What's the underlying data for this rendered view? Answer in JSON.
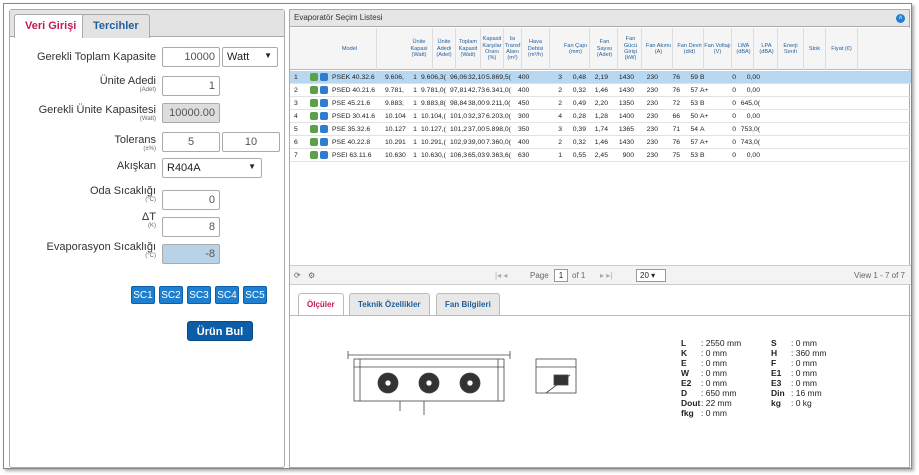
{
  "left_tabs": {
    "data_entry": "Veri Girişi",
    "preferences": "Tercihler"
  },
  "form": {
    "total_capacity_label": "Gerekli Toplam Kapasite",
    "total_capacity_value": "10000",
    "capacity_unit": "Watt",
    "unit_count_label": "Ünite Adedi",
    "unit_count_sub": "(Adet)",
    "unit_count_value": "1",
    "unit_capacity_label": "Gerekli Ünite Kapasitesi",
    "unit_capacity_sub": "(Watt)",
    "unit_capacity_value": "10000.00",
    "tolerance_label": "Tolerans",
    "tolerance_sub": "(±%)",
    "tolerance_min": "5",
    "tolerance_max": "10",
    "fluid_label": "Akışkan",
    "fluid_value": "R404A",
    "room_temp_label": "Oda Sıcaklığı",
    "room_temp_sub": "(°C)",
    "room_temp_value": "0",
    "dt_label": "ΔT",
    "dt_sub": "(K)",
    "dt_value": "8",
    "evap_temp_label": "Evaporasyon Sıcaklığı",
    "evap_temp_sub": "(°C)",
    "evap_temp_value": "-8",
    "sc_buttons": [
      "SC1",
      "SC2",
      "SC3",
      "SC4",
      "SC5"
    ],
    "find_button": "Ürün Bul"
  },
  "grid": {
    "title": "Evaporatör Seçim Listesi",
    "columns": [
      "Model",
      "Ünite Kapasi (Watt)",
      "Ünite Adedi (Adet)",
      "Toplam Kapasit (Watt)",
      "Kapasit Karşılar Oranı (%)",
      "Isı Transf Alanı (m²)",
      "Hava Debisi (m³/h)",
      "Fan Çapı (mm)",
      "Fan Sayısı (Adet)",
      "Fan Gücü Girişi (kW)",
      "Fan Akımı (A)",
      "Fan Devri (d/d)",
      "Fan Voltajı (V)",
      "LWA (dBA)",
      "LPA (dBA)",
      "Enerji Sınıfı",
      "Stok",
      "Fiyat (€)"
    ],
    "rows": [
      [
        "1",
        "PSEK 40.32.6",
        "9.606,",
        "1",
        "9.606,3(",
        "96,06",
        "32,10",
        "5.869,5(",
        "400",
        "3",
        "0,48",
        "2,19",
        "1430",
        "230",
        "76",
        "59",
        "B",
        "0",
        "0,00"
      ],
      [
        "2",
        "PSED 40.21.6",
        "9.781,",
        "1",
        "9.781,0(",
        "97,81",
        "42,73",
        "6.341,0(",
        "400",
        "2",
        "0,32",
        "1,46",
        "1430",
        "230",
        "76",
        "57",
        "A+",
        "0",
        "0,00"
      ],
      [
        "3",
        "PSE 45.21.6",
        "9.883,",
        "1",
        "9.883,8(",
        "98,84",
        "38,00",
        "9.211,0(",
        "450",
        "2",
        "0,49",
        "2,20",
        "1350",
        "230",
        "72",
        "53",
        "B",
        "0",
        "645,0("
      ],
      [
        "4",
        "PSED 30.41.6",
        "10.104",
        "1",
        "10.104,(",
        "101,04",
        "32,37",
        "6.203,0(",
        "300",
        "4",
        "0,28",
        "1,28",
        "1400",
        "230",
        "66",
        "50",
        "A+",
        "0",
        "0,00"
      ],
      [
        "5",
        "PSE 35.32.6",
        "10.127",
        "1",
        "10.127,(",
        "101,28",
        "37,00",
        "5.898,0(",
        "350",
        "3",
        "0,39",
        "1,74",
        "1365",
        "230",
        "71",
        "54",
        "A",
        "0",
        "753,0("
      ],
      [
        "6",
        "PSE 40.22.8",
        "10.291",
        "1",
        "10.291,(",
        "102,92",
        "39,00",
        "7.360,0(",
        "400",
        "2",
        "0,32",
        "1,46",
        "1430",
        "230",
        "76",
        "57",
        "A+",
        "0",
        "743,0("
      ],
      [
        "7",
        "PSEI 63.11.6",
        "10.630",
        "1",
        "10.630,(",
        "106,30",
        "65,03",
        "9.363,6(",
        "630",
        "1",
        "0,55",
        "2,45",
        "900",
        "230",
        "75",
        "53",
        "B",
        "0",
        "0,00"
      ]
    ]
  },
  "pager": {
    "page_word": "Page",
    "page_value": "1",
    "of_text": "of 1",
    "page_size": "20",
    "view_text": "View 1 - 7 of 7"
  },
  "bottom_tabs": {
    "dimensions": "Ölçüler",
    "technical": "Teknik Özellikler",
    "fan_info": "Fan Bilgileri"
  },
  "dimensions": [
    {
      "k": "L",
      "v": ": 2550 mm",
      "k2": "S",
      "v2": ": 0 mm"
    },
    {
      "k": "K",
      "v": ": 0 mm",
      "k2": "H",
      "v2": ": 360 mm"
    },
    {
      "k": "E",
      "v": ": 0 mm",
      "k2": "F",
      "v2": ": 0 mm"
    },
    {
      "k": "W",
      "v": ": 0 mm",
      "k2": "E1",
      "v2": ": 0 mm"
    },
    {
      "k": "E2",
      "v": ": 0 mm",
      "k2": "E3",
      "v2": ": 0 mm"
    },
    {
      "k": "D",
      "v": ": 650 mm",
      "k2": "Din",
      "v2": ": 16 mm"
    },
    {
      "k": "Dout",
      "v": ": 22 mm",
      "k2": "kg",
      "v2": ": 0 kg"
    },
    {
      "k": "fkg",
      "v": ": 0 mm",
      "k2": "",
      "v2": ""
    }
  ],
  "colors": {
    "accent_blue": "#1e7fd0",
    "selected_row": "#b8d8f2",
    "active_tab": "#c2185b"
  }
}
